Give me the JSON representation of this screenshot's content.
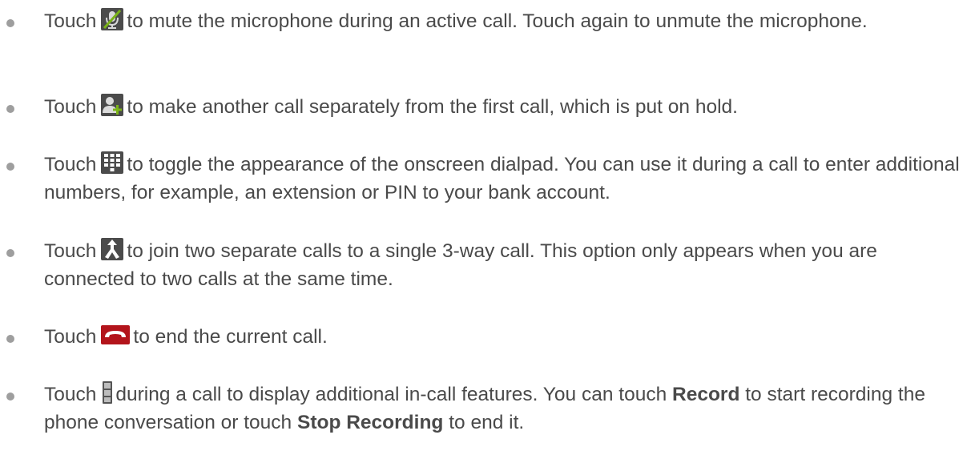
{
  "items": [
    {
      "before": "Touch",
      "icon": "mute-microphone-icon",
      "after": "to mute the microphone during an active call. Touch again to unmute the microphone."
    },
    {
      "before": "Touch",
      "icon": "add-call-icon",
      "after": "to make another call separately from the first call, which is put on hold."
    },
    {
      "before": "Touch",
      "icon": "dialpad-icon",
      "after": "to toggle the appearance of the onscreen dialpad. You can use it during a call to enter additional numbers, for example, an extension or PIN to your bank account."
    },
    {
      "before": "Touch",
      "icon": "merge-calls-icon",
      "after": "to join two separate calls to a single 3-way call. This option only appears when you are connected to two calls at the same time."
    },
    {
      "before": "Touch",
      "icon": "end-call-icon",
      "after": "to end the current call."
    },
    {
      "before": "Touch",
      "icon": "menu-icon",
      "after_1": "during a call to display additional in-call features. You can touch",
      "bold_1": "Record",
      "after_2": "to start recording the phone conversation or touch",
      "bold_2": "Stop Recording",
      "after_3": "to end it."
    }
  ]
}
